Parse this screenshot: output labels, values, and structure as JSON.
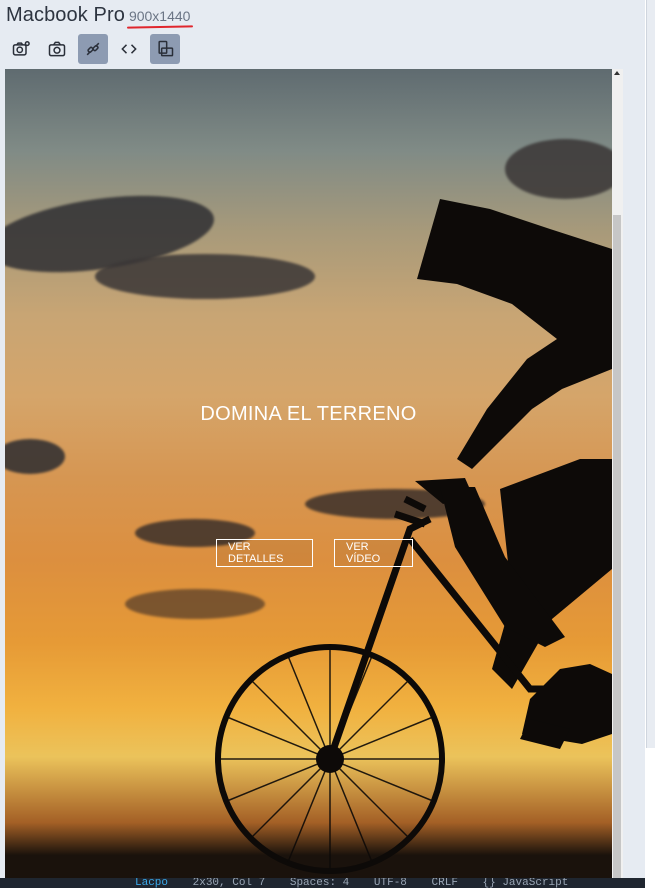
{
  "device": {
    "name": "Macbook Pro",
    "size": "900x1440"
  },
  "toolbar": {
    "items": [
      {
        "icon": "camera-settings-icon",
        "active": false
      },
      {
        "icon": "camera-icon",
        "active": false
      },
      {
        "icon": "sync-link-icon",
        "active": true
      },
      {
        "icon": "code-icon",
        "active": false
      },
      {
        "icon": "rotate-device-icon",
        "active": true
      }
    ]
  },
  "hero": {
    "title": "DOMINA EL TERRENO",
    "details_button": "VER DETALLES",
    "video_button": "VER VÍDEO"
  },
  "statusbar": {
    "items": [
      "Lacpo",
      "2x30, Col 7",
      "Spaces: 4",
      "UTF-8",
      "CRLF",
      "{} JavaScript"
    ]
  },
  "colors": {
    "accent_underline": "#e0262d",
    "active_tool": "#8d9bb2"
  }
}
